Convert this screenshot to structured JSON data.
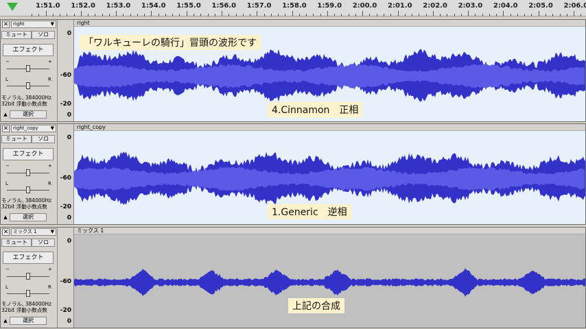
{
  "ruler": {
    "ticks": [
      "1:51.0",
      "1:52.0",
      "1:53.0",
      "1:54.0",
      "1:55.0",
      "1:56.0",
      "1:57.0",
      "1:58.0",
      "1:59.0",
      "2:00.0",
      "2:01.0",
      "2:02.0",
      "2:03.0",
      "2:04.0",
      "2:05.0",
      "2:06.0"
    ]
  },
  "colors": {
    "wave": "#3232c8",
    "wave_light": "#5a5ae6",
    "track_bg": "#e8f0fa",
    "mix_bg": "#c0c0c0",
    "note_bg": "#fdf2cb"
  },
  "tracks": [
    {
      "name": "right",
      "title": "right",
      "mute": "ミュート",
      "solo": "ソロ",
      "effect": "エフェクト",
      "gain_minus": "−",
      "gain_plus": "+",
      "pan_left": "L",
      "pan_right": "R",
      "info_line1": "モノラル, 384000Hz",
      "info_line2": "32bit 浮動小数点数",
      "select": "選択",
      "scale_top": "0",
      "scale_mid": "-60",
      "scale_bot": "-20",
      "scale_end": "0",
      "notes": [
        "「ワルキューレの騎行」冒頭の波形です",
        "4.Cinnamon　正相"
      ]
    },
    {
      "name": "right_copy",
      "title": "right_copy",
      "mute": "ミュート",
      "solo": "ソロ",
      "effect": "エフェクト",
      "gain_minus": "−",
      "gain_plus": "+",
      "pan_left": "L",
      "pan_right": "R",
      "info_line1": "モノラル, 384000Hz",
      "info_line2": "32bit 浮動小数点数",
      "select": "選択",
      "scale_top": "0",
      "scale_mid": "-60",
      "scale_bot": "-20",
      "scale_end": "0",
      "notes": [
        "1.Generic　逆相"
      ]
    },
    {
      "name": "ミックス 1",
      "title": "ミックス 1",
      "mute": "ミュート",
      "solo": "ソロ",
      "effect": "エフェクト",
      "gain_minus": "−",
      "gain_plus": "+",
      "pan_left": "L",
      "pan_right": "R",
      "info_line1": "モノラル, 384000Hz",
      "info_line2": "32bit 浮動小数点数",
      "select": "選択",
      "scale_top": "0",
      "scale_mid": "-60",
      "scale_bot": "-20",
      "scale_end": "0",
      "notes": [
        "上記の合成"
      ]
    }
  ]
}
